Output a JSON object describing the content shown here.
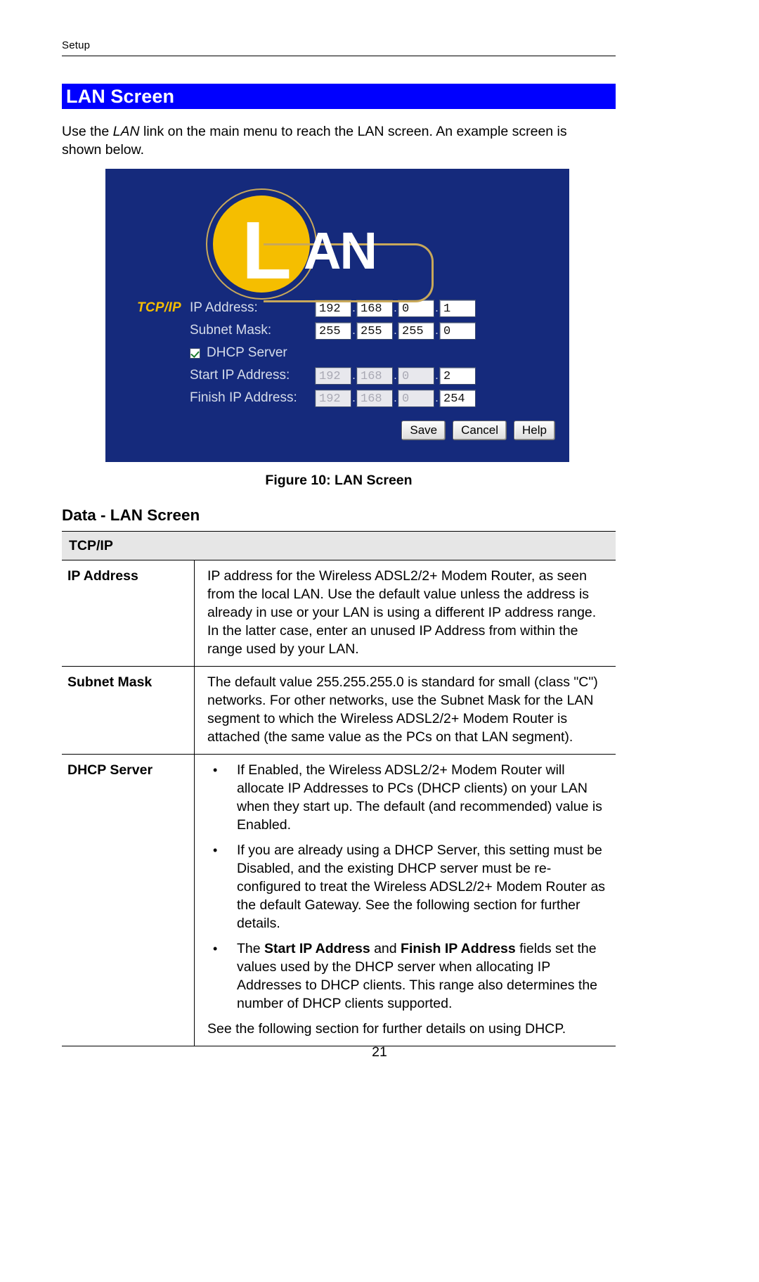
{
  "header": {
    "running_head": "Setup"
  },
  "title_banner": {
    "text": "LAN Screen",
    "bg_color": "#0000FF",
    "text_color": "#FFFFFF"
  },
  "intro": {
    "part1": "Use the ",
    "emphasis": "LAN",
    "part2": " link on the main menu to reach the LAN screen. An example screen is shown below."
  },
  "figure": {
    "caption": "Figure 10: LAN Screen",
    "bg_color": "#152A7C",
    "logo": {
      "disc_letter": "L",
      "word": "AN",
      "disc_color": "#F5BE00",
      "ring_color": "#C8A85A"
    },
    "form": {
      "group_label": "TCP/IP",
      "rows": [
        {
          "label": "IP Address:",
          "octets": [
            "192",
            "168",
            "0",
            "1"
          ],
          "disabled": [
            false,
            false,
            false,
            false
          ]
        },
        {
          "label": "Subnet Mask:",
          "octets": [
            "255",
            "255",
            "255",
            "0"
          ],
          "disabled": [
            false,
            false,
            false,
            false
          ]
        }
      ],
      "checkbox": {
        "label": "DHCP Server",
        "checked": true
      },
      "dhcp_rows": [
        {
          "label": "Start IP Address:",
          "octets": [
            "192",
            "168",
            "0",
            "2"
          ],
          "disabled": [
            true,
            true,
            true,
            false
          ]
        },
        {
          "label": "Finish IP Address:",
          "octets": [
            "192",
            "168",
            "0",
            "254"
          ],
          "disabled": [
            true,
            true,
            true,
            false
          ]
        }
      ],
      "buttons": [
        {
          "label": "Save"
        },
        {
          "label": "Cancel"
        },
        {
          "label": "Help"
        }
      ]
    }
  },
  "data_section": {
    "heading": "Data - LAN Screen",
    "section_header": "TCP/IP",
    "rows": [
      {
        "key": "IP Address",
        "text": "IP address for the Wireless ADSL2/2+ Modem Router, as seen from the local LAN. Use the default value unless the address is already in use or your LAN is using a different IP address range. In the latter case, enter an unused IP Address from within the range used by your LAN."
      },
      {
        "key": "Subnet Mask",
        "text": "The default value 255.255.255.0 is standard for small (class \"C\") networks. For other networks, use the Subnet Mask for the LAN segment to which the Wireless ADSL2/2+ Modem Router is attached (the same value as the PCs on that LAN segment)."
      }
    ],
    "dhcp_row": {
      "key": "DHCP Server",
      "bullets": [
        {
          "pre": "If Enabled, the Wireless ADSL2/2+ Modem Router will allocate IP Addresses to PCs (DHCP clients) on your LAN when they start up. The default (and recommended) value is Enabled.",
          "bold1": "",
          "mid": "",
          "bold2": "",
          "post": ""
        },
        {
          "pre": "If you are already using a DHCP Server, this setting must be Disabled, and the existing DHCP server must be re-configured to treat the Wireless ADSL2/2+ Modem Router as the default Gateway. See the following section for further details.",
          "bold1": "",
          "mid": "",
          "bold2": "",
          "post": ""
        },
        {
          "pre": "The ",
          "bold1": "Start IP Address",
          "mid": " and ",
          "bold2": "Finish IP Address",
          "post": " fields set the values used by the DHCP server when allocating IP Addresses to DHCP clients. This range also determines the number of DHCP clients supported."
        }
      ],
      "trailing_note": "See the following section for further details on using DHCP."
    }
  },
  "footer": {
    "page_number": "21"
  }
}
